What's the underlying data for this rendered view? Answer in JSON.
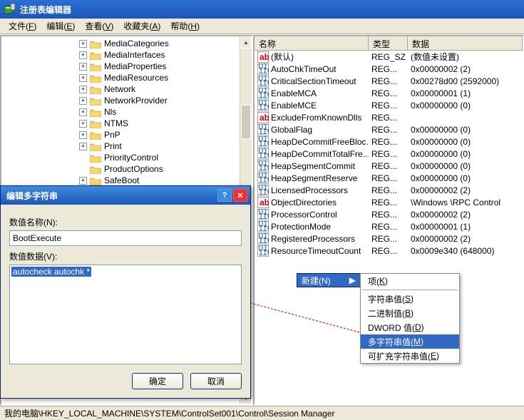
{
  "window_title": "注册表编辑器",
  "menus": [
    "文件(F)",
    "编辑(E)",
    "查看(V)",
    "收藏夹(A)",
    "帮助(H)"
  ],
  "tree": [
    {
      "indent": 7,
      "expand": "+",
      "label": "MediaCategories"
    },
    {
      "indent": 7,
      "expand": "+",
      "label": "MediaInterfaces"
    },
    {
      "indent": 7,
      "expand": "+",
      "label": "MediaProperties"
    },
    {
      "indent": 7,
      "expand": "+",
      "label": "MediaResources"
    },
    {
      "indent": 7,
      "expand": "+",
      "label": "Network"
    },
    {
      "indent": 7,
      "expand": "+",
      "label": "NetworkProvider"
    },
    {
      "indent": 7,
      "expand": "+",
      "label": "Nls"
    },
    {
      "indent": 7,
      "expand": "+",
      "label": "NTMS"
    },
    {
      "indent": 7,
      "expand": "+",
      "label": "PnP"
    },
    {
      "indent": 7,
      "expand": "+",
      "label": "Print"
    },
    {
      "indent": 7,
      "expand": "",
      "label": "PriorityControl"
    },
    {
      "indent": 7,
      "expand": "",
      "label": "ProductOptions"
    },
    {
      "indent": 7,
      "expand": "+",
      "label": "SafeBoot"
    }
  ],
  "list_headers": {
    "name": "名称",
    "type": "类型",
    "data": "数据"
  },
  "values": [
    {
      "ico": "sz",
      "name": "(默认)",
      "type": "REG_SZ",
      "data": "(数值未设置)"
    },
    {
      "ico": "bin",
      "name": "AutoChkTimeOut",
      "type": "REG...",
      "data": "0x00000002 (2)"
    },
    {
      "ico": "bin",
      "name": "CriticalSectionTimeout",
      "type": "REG...",
      "data": "0x00278d00 (2592000)"
    },
    {
      "ico": "bin",
      "name": "EnableMCA",
      "type": "REG...",
      "data": "0x00000001 (1)"
    },
    {
      "ico": "bin",
      "name": "EnableMCE",
      "type": "REG...",
      "data": "0x00000000 (0)"
    },
    {
      "ico": "sz",
      "name": "ExcludeFromKnownDlls",
      "type": "REG...",
      "data": ""
    },
    {
      "ico": "bin",
      "name": "GlobalFlag",
      "type": "REG...",
      "data": "0x00000000 (0)"
    },
    {
      "ico": "bin",
      "name": "HeapDeCommitFreeBloc...",
      "type": "REG...",
      "data": "0x00000000 (0)"
    },
    {
      "ico": "bin",
      "name": "HeapDeCommitTotalFre...",
      "type": "REG...",
      "data": "0x00000000 (0)"
    },
    {
      "ico": "bin",
      "name": "HeapSegmentCommit",
      "type": "REG...",
      "data": "0x00000000 (0)"
    },
    {
      "ico": "bin",
      "name": "HeapSegmentReserve",
      "type": "REG...",
      "data": "0x00000000 (0)"
    },
    {
      "ico": "bin",
      "name": "LicensedProcessors",
      "type": "REG...",
      "data": "0x00000002 (2)"
    },
    {
      "ico": "sz",
      "name": "ObjectDirectories",
      "type": "REG...",
      "data": "\\Windows \\RPC Control"
    },
    {
      "ico": "bin",
      "name": "ProcessorControl",
      "type": "REG...",
      "data": "0x00000002 (2)"
    },
    {
      "ico": "bin",
      "name": "ProtectionMode",
      "type": "REG...",
      "data": "0x00000001 (1)"
    },
    {
      "ico": "bin",
      "name": "RegisteredProcessors",
      "type": "REG...",
      "data": "0x00000002 (2)"
    },
    {
      "ico": "bin",
      "name": "ResourceTimeoutCount",
      "type": "REG...",
      "data": "0x0009e340 (648000)"
    }
  ],
  "dialog": {
    "title": "编辑多字符串",
    "name_label": "数值名称(N):",
    "name_value": "BootExecute",
    "data_label": "数值数据(V):",
    "data_value": "autocheck autochk *",
    "ok": "确定",
    "cancel": "取消"
  },
  "context": {
    "new": "新建(N)",
    "items": [
      {
        "label": "项(K)",
        "hl": false,
        "sep_after": true
      },
      {
        "label": "字符串值(S)",
        "hl": false
      },
      {
        "label": "二进制值(B)",
        "hl": false
      },
      {
        "label": "DWORD 值(D)",
        "hl": false
      },
      {
        "label": "多字符串值(M)",
        "hl": true
      },
      {
        "label": "可扩充字符串值(E)",
        "hl": false
      }
    ]
  },
  "status": "我的电脑\\HKEY_LOCAL_MACHINE\\SYSTEM\\ControlSet001\\Control\\Session Manager"
}
